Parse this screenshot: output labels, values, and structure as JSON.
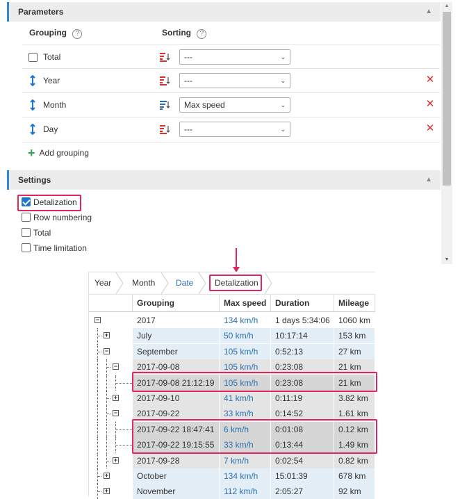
{
  "parameters": {
    "title": "Parameters",
    "grouping_header": "Grouping",
    "sorting_header": "Sorting",
    "help_glyph": "?",
    "rows": [
      {
        "label": "Total",
        "type": "checkbox",
        "sort": "---",
        "removable": false
      },
      {
        "label": "Year",
        "type": "drag",
        "sort": "---",
        "removable": true
      },
      {
        "label": "Month",
        "type": "drag",
        "sort": "Max speed",
        "removable": true
      },
      {
        "label": "Day",
        "type": "drag",
        "sort": "---",
        "removable": true
      }
    ],
    "add_grouping_label": "Add grouping"
  },
  "settings": {
    "title": "Settings",
    "options": [
      {
        "label": "Detalization",
        "checked": true
      },
      {
        "label": "Row numbering",
        "checked": false
      },
      {
        "label": "Total",
        "checked": false
      },
      {
        "label": "Time limitation",
        "checked": false
      }
    ]
  },
  "report": {
    "breadcrumb": [
      "Year",
      "Month",
      "Date",
      "Detalization"
    ],
    "columns": [
      "Grouping",
      "Max speed",
      "Duration",
      "Mileage"
    ],
    "rows": [
      {
        "level": 0,
        "toggle": "minus",
        "grouping": "2017",
        "max_speed": "134 km/h",
        "duration": "1 days 5:34:06",
        "mileage": "1060 km"
      },
      {
        "level": 1,
        "toggle": "plus",
        "grouping": "July",
        "max_speed": "50 km/h",
        "duration": "10:17:14",
        "mileage": "153 km"
      },
      {
        "level": 1,
        "toggle": "minus",
        "grouping": "September",
        "max_speed": "105 km/h",
        "duration": "0:52:13",
        "mileage": "27 km"
      },
      {
        "level": 2,
        "toggle": "minus",
        "grouping": "2017-09-08",
        "max_speed": "105 km/h",
        "duration": "0:23:08",
        "mileage": "21 km"
      },
      {
        "level": 3,
        "toggle": "none",
        "grouping": "2017-09-08 21:12:19",
        "max_speed": "105 km/h",
        "duration": "0:23:08",
        "mileage": "21 km"
      },
      {
        "level": 2,
        "toggle": "plus",
        "grouping": "2017-09-10",
        "max_speed": "41 km/h",
        "duration": "0:11:19",
        "mileage": "3.82 km"
      },
      {
        "level": 2,
        "toggle": "minus",
        "grouping": "2017-09-22",
        "max_speed": "33 km/h",
        "duration": "0:14:52",
        "mileage": "1.61 km"
      },
      {
        "level": 3,
        "toggle": "none",
        "grouping": "2017-09-22 18:47:41",
        "max_speed": "6 km/h",
        "duration": "0:01:08",
        "mileage": "0.12 km"
      },
      {
        "level": 3,
        "toggle": "none",
        "grouping": "2017-09-22 19:15:55",
        "max_speed": "33 km/h",
        "duration": "0:13:44",
        "mileage": "1.49 km"
      },
      {
        "level": 2,
        "toggle": "plus",
        "grouping": "2017-09-28",
        "max_speed": "7 km/h",
        "duration": "0:02:54",
        "mileage": "0.82 km"
      },
      {
        "level": 1,
        "toggle": "plus",
        "grouping": "October",
        "max_speed": "134 km/h",
        "duration": "15:01:39",
        "mileage": "678 km"
      },
      {
        "level": 1,
        "toggle": "plus",
        "grouping": "November",
        "max_speed": "112 km/h",
        "duration": "2:05:27",
        "mileage": "92 km"
      }
    ]
  },
  "colors": {
    "accent": "#2f86d3",
    "highlight": "#e0245e",
    "link": "#2a6fb0",
    "remove": "#d9302c",
    "add": "#2ea44f"
  }
}
